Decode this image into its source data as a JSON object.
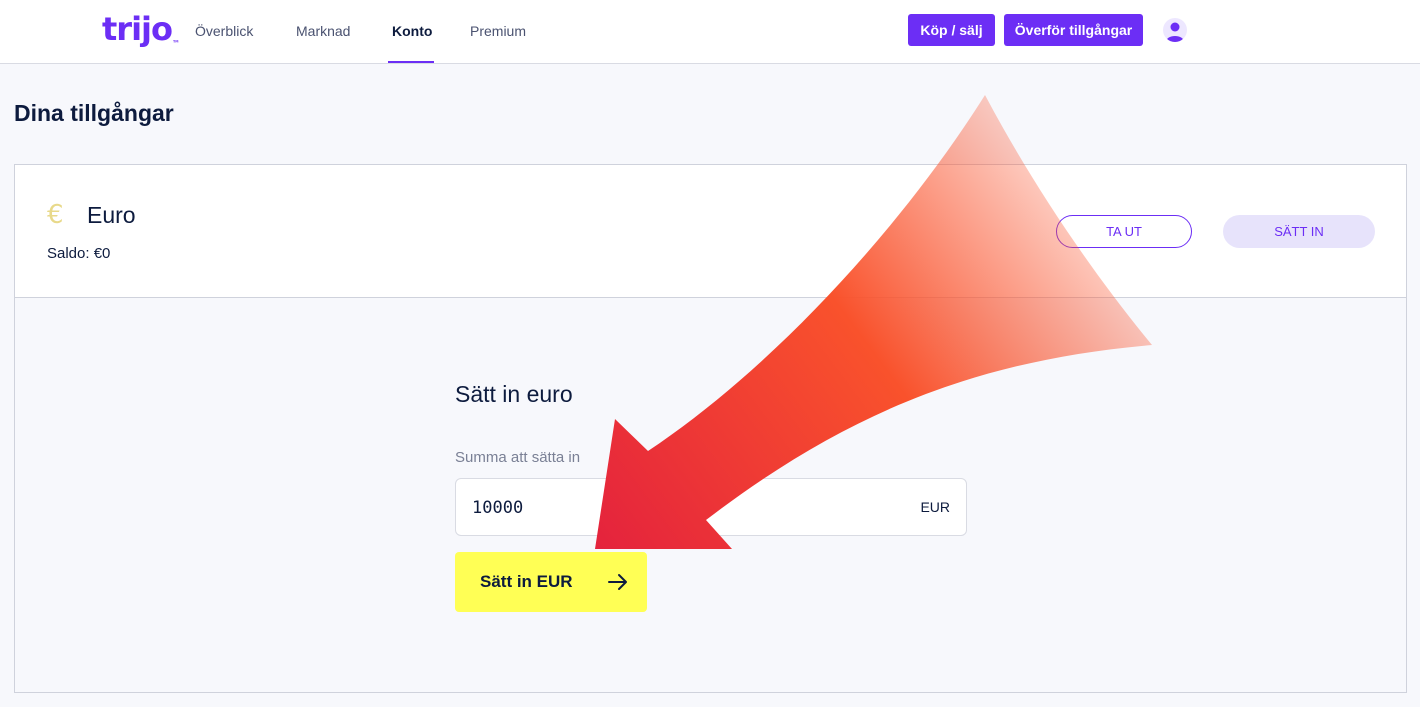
{
  "header": {
    "logo": "trijo",
    "logo_mark": "™",
    "nav": [
      {
        "label": "Överblick",
        "active": false
      },
      {
        "label": "Marknad",
        "active": false
      },
      {
        "label": "Konto",
        "active": true
      },
      {
        "label": "Premium",
        "active": false
      }
    ],
    "buy_sell_label": "Köp / sälj",
    "transfer_label": "Överför tillgångar",
    "avatar_icon": "user-icon"
  },
  "page": {
    "title": "Dina tillgångar"
  },
  "asset": {
    "icon": "euro-icon",
    "symbol": "€",
    "name": "Euro",
    "balance": "Saldo: €0",
    "withdraw_label": "TA UT",
    "deposit_label": "SÄTT IN"
  },
  "deposit": {
    "title": "Sätt in euro",
    "amount_label": "Summa att sätta in",
    "amount_value": "10000",
    "currency": "EUR",
    "submit_label": "Sätt in EUR",
    "submit_icon": "arrow-right-icon"
  },
  "colors": {
    "brand": "#6c2ef5",
    "cta": "#ffff55",
    "annotation_arrow": "#e8293a"
  }
}
